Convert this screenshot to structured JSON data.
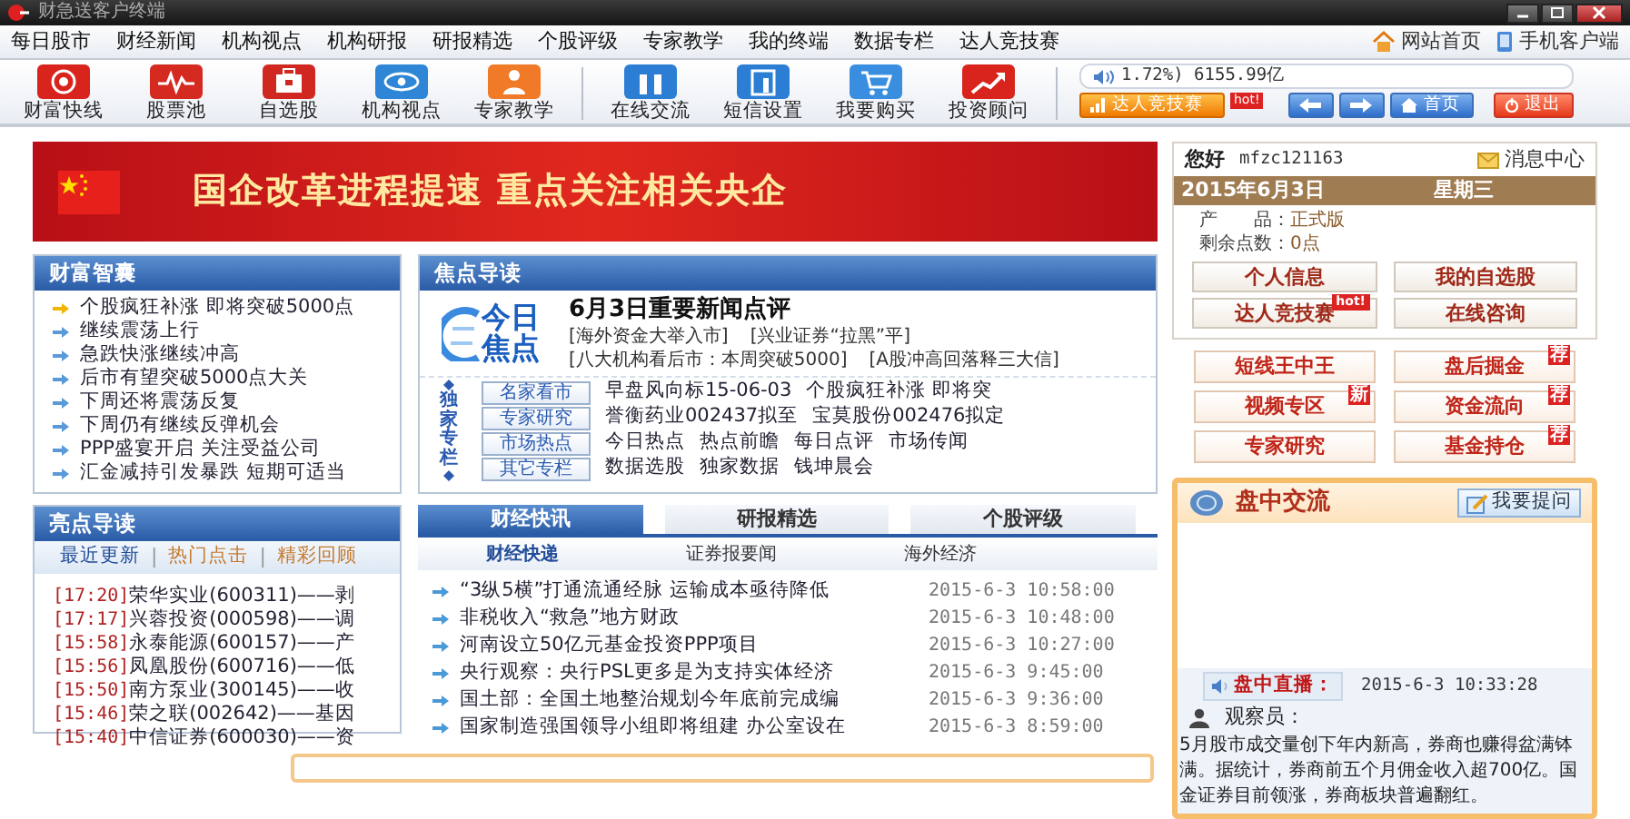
{
  "window": {
    "title": "财急送客户终端"
  },
  "menu": {
    "items": [
      "每日股市",
      "财经新闻",
      "机构视点",
      "机构研报",
      "研报精选",
      "个股评级",
      "专家教学",
      "我的终端",
      "数据专栏",
      "达人竞技赛"
    ],
    "links": [
      {
        "kind": "home",
        "label": "网站首页"
      },
      {
        "kind": "mobile",
        "label": "手机客户端"
      }
    ]
  },
  "toolbar": {
    "groups": [
      [
        {
          "kind": "target",
          "label": "财富快线"
        },
        {
          "kind": "pulse",
          "label": "股票池"
        },
        {
          "kind": "briefcase",
          "label": "自选股"
        },
        {
          "kind": "eye",
          "label": "机构视点"
        },
        {
          "kind": "person",
          "label": "专家教学"
        }
      ],
      [
        {
          "kind": "pillars",
          "label": "在线交流"
        },
        {
          "kind": "document",
          "label": "短信设置"
        },
        {
          "kind": "cart",
          "label": "我要购买"
        },
        {
          "kind": "trend",
          "label": "投资顾问"
        }
      ]
    ]
  },
  "ticker": {
    "text": "1.72%) 6155.99亿"
  },
  "nav_buttons": [
    {
      "kind": "contest",
      "label": "达人竞技赛",
      "badge": "hot!"
    },
    {
      "kind": "back"
    },
    {
      "kind": "forward"
    },
    {
      "kind": "home",
      "label": "首页"
    },
    {
      "kind": "exit",
      "label": "退出"
    }
  ],
  "banner": {
    "text": "国企改革进程提速  重点关注相关央企"
  },
  "wealth_panel": {
    "title": "财富智囊",
    "items": [
      {
        "text": "个股疯狂补涨 即将突破5000点",
        "selected": true
      },
      {
        "text": "继续震荡上行",
        "selected": false
      },
      {
        "text": "急跌快涨继续冲高",
        "selected": false
      },
      {
        "text": "后市有望突破5000点大关",
        "selected": false
      },
      {
        "text": "下周还将震荡反复",
        "selected": false
      },
      {
        "text": "下周仍有继续反弹机会",
        "selected": false
      },
      {
        "text": "PPP盛宴开启 关注受益公司",
        "selected": false
      },
      {
        "text": "汇金减持引发暴跌 短期可适当",
        "selected": false
      }
    ]
  },
  "focus_panel": {
    "title": "焦点导读",
    "logo": "今日焦点",
    "headline": "6月3日重要新闻点评",
    "links": [
      [
        "[海外资金大举入市]",
        "[兴业证券“拉黑”平]"
      ],
      [
        "[八大机构看后市：本周突破5000]",
        "[A股冲高回落释三大信]"
      ]
    ],
    "column_label": "独家专栏",
    "columns": [
      {
        "tag": "名家看市",
        "links": [
          "早盘风向标15-06-03",
          "个股疯狂补涨 即将突"
        ]
      },
      {
        "tag": "专家研究",
        "links": [
          "誉衡药业002437拟至",
          "宝莫股份002476拟定"
        ]
      },
      {
        "tag": "市场热点",
        "links": [
          "今日热点",
          "热点前瞻",
          "每日点评",
          "市场传闻"
        ]
      },
      {
        "tag": "其它专栏",
        "links": [
          "数据选股",
          "独家数据",
          "钱坤晨会"
        ]
      }
    ]
  },
  "highlights_panel": {
    "title": "亮点导读",
    "separator": "|",
    "tabs": [
      {
        "label": "最近更新",
        "selected": true
      },
      {
        "label": "热门点击",
        "selected": false
      },
      {
        "label": "精彩回顾",
        "selected": false
      }
    ],
    "items": [
      {
        "time": "[17:20]",
        "text": "荣华实业(600311)——剥"
      },
      {
        "time": "[17:17]",
        "text": "兴蓉投资(000598)——调"
      },
      {
        "time": "[15:58]",
        "text": "永泰能源(600157)——产"
      },
      {
        "time": "[15:56]",
        "text": "凤凰股份(600716)——低"
      },
      {
        "time": "[15:50]",
        "text": "南方泵业(300145)——收"
      },
      {
        "time": "[15:46]",
        "text": "荣之联(002642)——基因"
      },
      {
        "time": "[15:40]",
        "text": "中信证券(600030)——资"
      }
    ]
  },
  "news_panel": {
    "tabs": [
      {
        "label": "财经快讯",
        "selected": true
      },
      {
        "label": "研报精选",
        "selected": false
      },
      {
        "label": "个股评级",
        "selected": false
      }
    ],
    "subtabs": [
      {
        "label": "财经快递",
        "selected": true
      },
      {
        "label": "证券报要闻",
        "selected": false
      },
      {
        "label": "海外经济",
        "selected": false
      }
    ],
    "items": [
      {
        "title": "“3纵5横”打通流通经脉 运输成本亟待降低",
        "time": "2015-6-3 10:58:00"
      },
      {
        "title": "非税收入“救急”地方财政",
        "time": "2015-6-3 10:48:00"
      },
      {
        "title": "河南设立50亿元基金投资PPP项目",
        "time": "2015-6-3 10:27:00"
      },
      {
        "title": "央行观察：央行PSL更多是为支持实体经济",
        "time": "2015-6-3 9:45:00"
      },
      {
        "title": "国土部：全国土地整治规划今年底前完成编",
        "time": "2015-6-3 9:36:00"
      },
      {
        "title": "国家制造强国领导小组即将组建 办公室设在",
        "time": "2015-6-3 8:59:00"
      }
    ]
  },
  "account": {
    "greeting": "您好",
    "user": "mfzc121163",
    "message_center": "消息中心",
    "date": "2015年6月3日",
    "weekday": "星期三",
    "fields": [
      {
        "label": "产　　品：",
        "value": "正式版"
      },
      {
        "label": "剩余点数：",
        "value": "0点"
      }
    ],
    "buttons": [
      {
        "label": "个人信息"
      },
      {
        "label": "我的自选股"
      },
      {
        "label": "达人竞技赛",
        "badge": "hot!"
      },
      {
        "label": "在线咨询"
      }
    ]
  },
  "features": [
    {
      "label": "短线王中王"
    },
    {
      "label": "盘后掘金",
      "badge": "荐"
    },
    {
      "label": "视频专区",
      "badge": "新"
    },
    {
      "label": "资金流向",
      "badge": "荐"
    },
    {
      "label": "专家研究"
    },
    {
      "label": "基金持仓",
      "badge": "荐"
    }
  ],
  "chat": {
    "title": "盘中交流",
    "ask_button": "我要提问",
    "live_tag": "盘中直播：",
    "time": "2015-6-3 10:33:28",
    "author": "观察员：",
    "message": "5月股市成交量创下年内新高，券商也赚得盆满钵满。据统计，券商前五个月佣金收入超700亿。国金证券目前领涨，券商板块普遍翻红。"
  }
}
